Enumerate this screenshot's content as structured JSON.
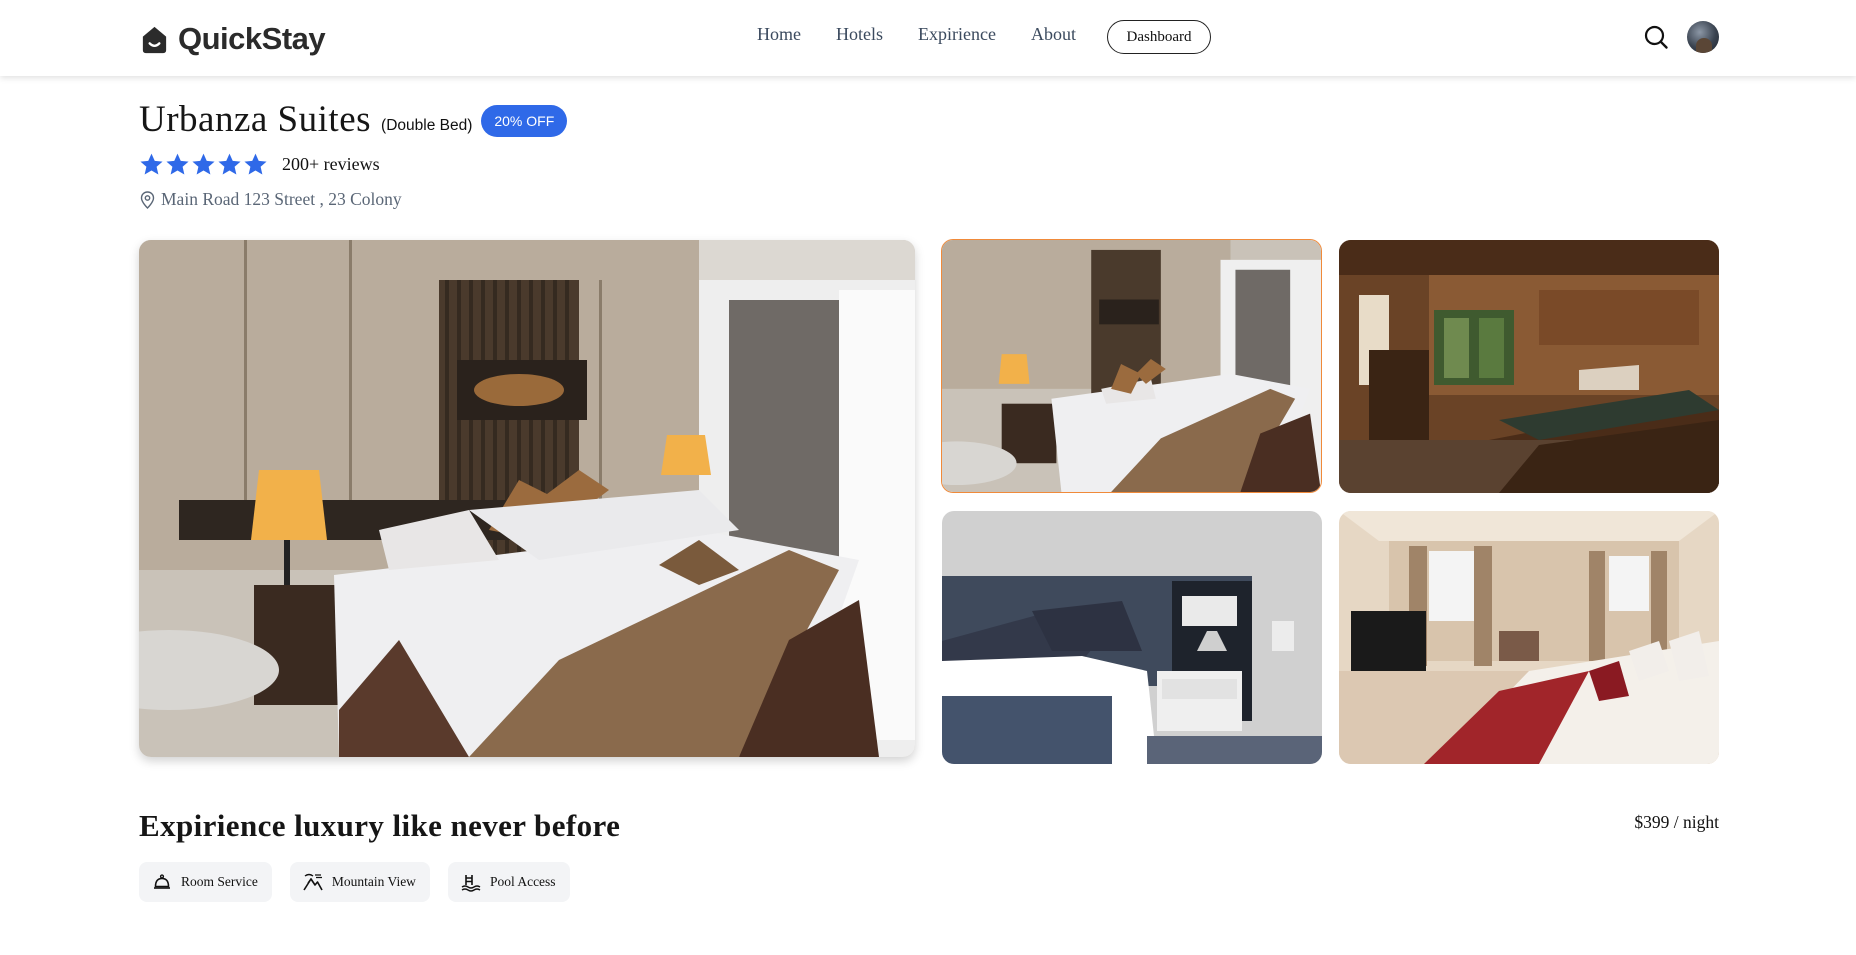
{
  "brand": {
    "name": "QuickStay",
    "icon": "house-logo-icon"
  },
  "nav": {
    "links": [
      {
        "label": "Home"
      },
      {
        "label": "Hotels"
      },
      {
        "label": "Expirience"
      },
      {
        "label": "About"
      }
    ],
    "dashboard_label": "Dashboard",
    "search_icon": "search-icon",
    "avatar_icon": "user-avatar"
  },
  "hotel": {
    "name": "Urbanza Suites",
    "room_type": "(Double Bed)",
    "discount": "20% OFF",
    "rating": 5,
    "rating_max": 5,
    "reviews": "200+ reviews",
    "address": "Main Road 123 Street , 23 Colony",
    "address_icon": "location-pin-icon"
  },
  "gallery": {
    "images": [
      {
        "name": "main-room-photo",
        "description_icon": "hotel-room-image"
      },
      {
        "name": "room-thumb-1",
        "selected": true
      },
      {
        "name": "room-thumb-2",
        "selected": false
      },
      {
        "name": "room-thumb-3",
        "selected": false
      },
      {
        "name": "room-thumb-4",
        "selected": false
      }
    ]
  },
  "details": {
    "tagline": "Expirience luxury like never before",
    "price": "$399 / night",
    "amenities": [
      {
        "label": "Room Service",
        "icon": "room-service-icon"
      },
      {
        "label": "Mountain View",
        "icon": "mountain-view-icon"
      },
      {
        "label": "Pool Access",
        "icon": "pool-access-icon"
      }
    ]
  },
  "colors": {
    "accent": "#2f69e8",
    "star": "#2f69e8",
    "selected_border": "#f08a3a",
    "chip_bg": "#f3f4f6"
  }
}
